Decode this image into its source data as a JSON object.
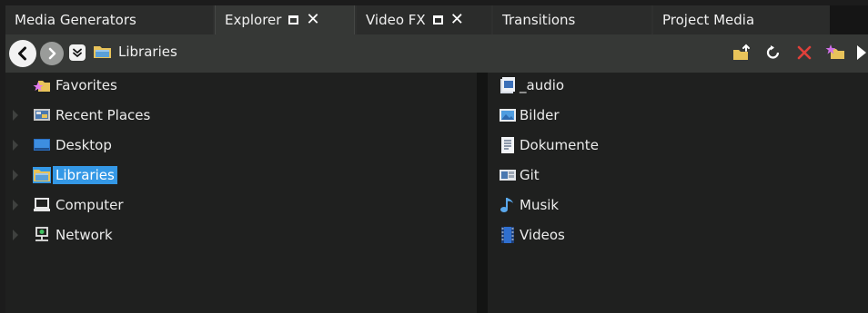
{
  "tabs": [
    {
      "label": "Media Generators"
    },
    {
      "label": "Explorer"
    },
    {
      "label": "Video FX"
    },
    {
      "label": "Transitions"
    },
    {
      "label": "Project Media"
    }
  ],
  "toolbar": {
    "address_label": "Libraries",
    "icons": [
      "back-arrow-icon",
      "forward-arrow-icon",
      "recent-locations-icon",
      "libraries-folder-icon",
      "up-folder-icon",
      "refresh-icon",
      "delete-icon",
      "add-favorite-icon",
      "play-icon"
    ]
  },
  "tree": [
    {
      "label": "Favorites",
      "icon": "favorites-star-folder-icon",
      "expandable": false
    },
    {
      "label": "Recent Places",
      "icon": "recent-places-icon",
      "expandable": true
    },
    {
      "label": "Desktop",
      "icon": "desktop-icon",
      "expandable": true
    },
    {
      "label": "Libraries",
      "icon": "libraries-folder-icon",
      "expandable": true,
      "selected": true
    },
    {
      "label": "Computer",
      "icon": "computer-icon",
      "expandable": true
    },
    {
      "label": "Network",
      "icon": "network-icon",
      "expandable": true
    }
  ],
  "files": [
    {
      "label": "_audio",
      "icon": "audio-library-icon"
    },
    {
      "label": "Bilder",
      "icon": "pictures-library-icon"
    },
    {
      "label": "Dokumente",
      "icon": "documents-library-icon"
    },
    {
      "label": "Git",
      "icon": "git-library-icon"
    },
    {
      "label": "Musik",
      "icon": "music-library-icon"
    },
    {
      "label": "Videos",
      "icon": "videos-library-icon"
    }
  ],
  "colors": {
    "selection": "#3498e6",
    "delete": "#e0403a",
    "folder": "#e8c35a"
  }
}
